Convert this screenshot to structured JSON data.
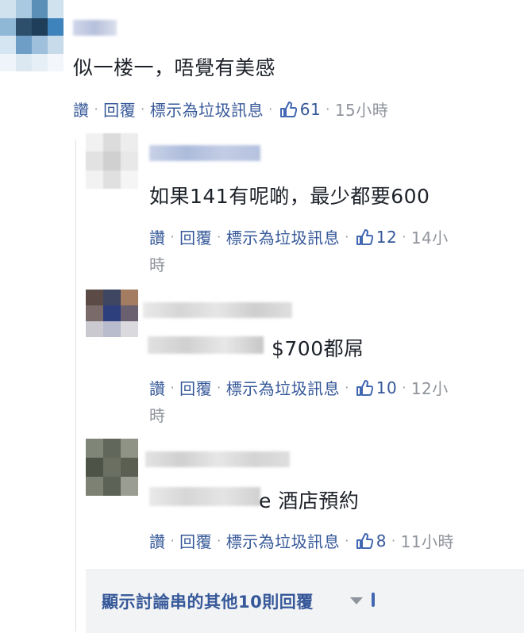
{
  "comments": [
    {
      "text": "似一楼一，唔覺有美感",
      "actions": {
        "like": "讚",
        "reply": "回覆",
        "spam": "標示為垃圾訊息",
        "likes": "61",
        "time": "15小時"
      }
    },
    {
      "text": "如果141有呢啲，最少都要600",
      "actions": {
        "like": "讚",
        "reply": "回覆",
        "spam": "標示為垃圾訊息",
        "likes": "12",
        "time": "14小",
        "time_wrap": "時"
      }
    },
    {
      "text": "$700都屌",
      "actions": {
        "like": "讚",
        "reply": "回覆",
        "spam": "標示為垃圾訊息",
        "likes": "10",
        "time": "12小",
        "time_wrap": "時"
      }
    },
    {
      "text": "e 酒店預約",
      "actions": {
        "like": "讚",
        "reply": "回覆",
        "spam": "標示為垃圾訊息",
        "likes": "8",
        "time": "11小時"
      }
    }
  ],
  "more_replies": {
    "label": "顯示討論串的其他10則回覆"
  },
  "colors": {
    "link": "#365899",
    "meta": "#90949c",
    "text": "#1d2129",
    "thread_bg": "#f2f3f5"
  },
  "icons": [
    "thumbs-up-icon",
    "caret-down-icon"
  ]
}
